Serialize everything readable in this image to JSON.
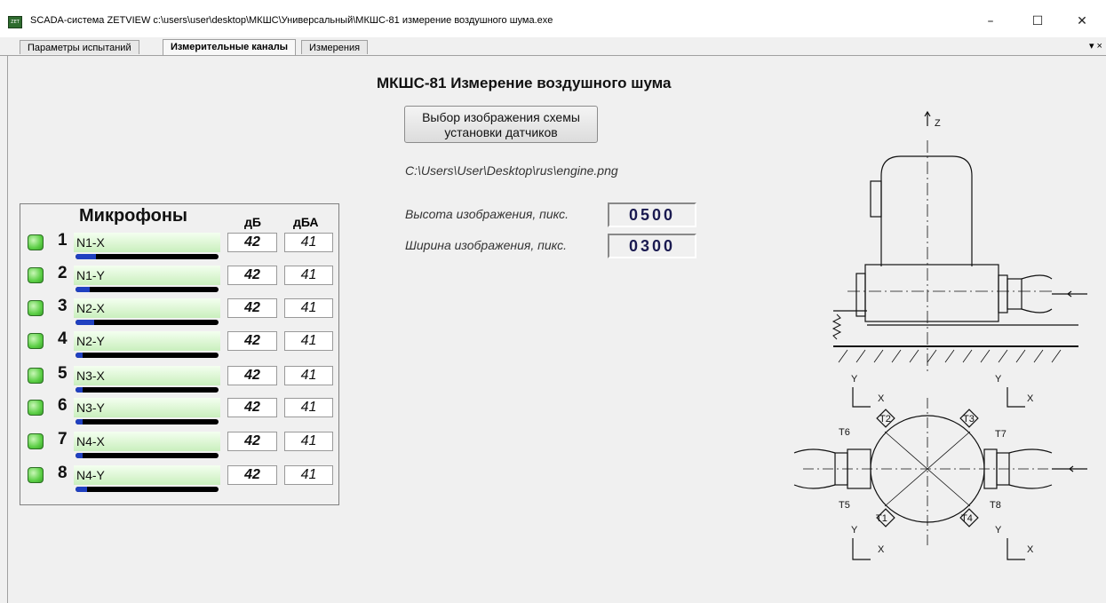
{
  "window": {
    "title": "SCADA-система ZETVIEW c:\\users\\user\\desktop\\МКШС\\Универсальный\\МКШС-81 измерение воздушного шума.exe",
    "app_icon": "zetview-icon",
    "minimize": "–",
    "maximize": "☐",
    "close": "✕"
  },
  "tabs": [
    {
      "label": "Параметры испытаний",
      "active": false
    },
    {
      "label": "Измерительные каналы",
      "active": true
    },
    {
      "label": "Измерения",
      "active": false
    }
  ],
  "tab_menu": "▾ ×",
  "main": {
    "title": "МКШС-81 Измерение воздушного шума",
    "choose_button_line1": "Выбор изображения схемы",
    "choose_button_line2": "установки датчиков",
    "image_path": "C:\\Users\\User\\Desktop\\rus\\engine.png",
    "height_label": "Высота изображения, пикс.",
    "height_value": "0500",
    "width_label": "Ширина изображения, пикс.",
    "width_value": "0300"
  },
  "mic_panel": {
    "header": "Микрофоны",
    "col_db": "дБ",
    "col_dba": "дБА",
    "led_color": "#5ccf46",
    "channels": [
      {
        "num": "1",
        "name": "N1-X",
        "db": "42",
        "dba": "41",
        "level": 0.14
      },
      {
        "num": "2",
        "name": "N1-Y",
        "db": "42",
        "dba": "41",
        "level": 0.1
      },
      {
        "num": "3",
        "name": "N2-X",
        "db": "42",
        "dba": "41",
        "level": 0.13
      },
      {
        "num": "4",
        "name": "N2-Y",
        "db": "42",
        "dba": "41",
        "level": 0.05
      },
      {
        "num": "5",
        "name": "N3-X",
        "db": "42",
        "dba": "41",
        "level": 0.05
      },
      {
        "num": "6",
        "name": "N3-Y",
        "db": "42",
        "dba": "41",
        "level": 0.05
      },
      {
        "num": "7",
        "name": "N4-X",
        "db": "42",
        "dba": "41",
        "level": 0.05
      },
      {
        "num": "8",
        "name": "N4-Y",
        "db": "42",
        "dba": "41",
        "level": 0.08
      }
    ]
  },
  "schematic": {
    "z_label": "Z",
    "axis_x": "X",
    "axis_y": "Y",
    "sensors": [
      "T1",
      "T2",
      "T3",
      "T4",
      "T5",
      "T6",
      "T7",
      "T8"
    ]
  }
}
